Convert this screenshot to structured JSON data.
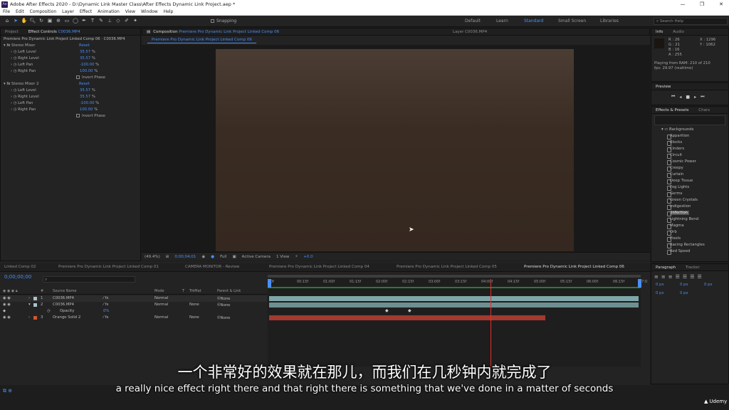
{
  "window": {
    "title": "Adobe After Effects 2020 - D:\\Dynamic Link Master Class\\After Effects Dynamic Link Project.aep *",
    "logo": "Ae",
    "controls": [
      "—",
      "❐",
      "✕"
    ]
  },
  "menu": [
    "File",
    "Edit",
    "Composition",
    "Layer",
    "Effect",
    "Animation",
    "View",
    "Window",
    "Help"
  ],
  "toolbar": {
    "snapping_label": "Snapping",
    "workspaces": [
      "Default",
      "Learn",
      "Standard",
      "Small Screen",
      "Libraries"
    ],
    "active_workspace": "Standard",
    "search_placeholder": "Search Help"
  },
  "left_panel": {
    "tabs": [
      "Project",
      "Effect Controls"
    ],
    "effect_controls_target": "C0036.MP4",
    "breadcrumb": "Premiere Pro Dynamic Link Project Linked Comp 06 · C0036.MP4",
    "effects": [
      {
        "name": "Stereo Mixer",
        "reset": "Reset",
        "params": [
          {
            "label": "Left Level",
            "value": "35.57",
            "unit": "%"
          },
          {
            "label": "Right Level",
            "value": "35.57",
            "unit": "%"
          },
          {
            "label": "Left Pan",
            "value": "-100.00",
            "unit": "%"
          },
          {
            "label": "Right Pan",
            "value": "100.00",
            "unit": "%"
          }
        ],
        "checkbox": "Invert Phase"
      },
      {
        "name": "Stereo Mixer 2",
        "reset": "Reset",
        "params": [
          {
            "label": "Left Level",
            "value": "35.57",
            "unit": "%"
          },
          {
            "label": "Right Level",
            "value": "35.57",
            "unit": "%"
          },
          {
            "label": "Left Pan",
            "value": "-100.00",
            "unit": "%"
          },
          {
            "label": "Right Pan",
            "value": "100.00",
            "unit": "%"
          }
        ],
        "checkbox": "Invert Phase"
      }
    ]
  },
  "composition_panel": {
    "tab_label": "Composition",
    "comp_name": "Premiere Pro Dynamic Link Project Linked Comp 06",
    "layer_tab": "Layer C0036.MP4",
    "sub_tab": "Premiere Pro Dynamic Link Project Linked Comp 06",
    "viewer": {
      "zoom": "(49.4%)",
      "timecode": "0;00;04;01",
      "resolution": "Full",
      "camera": "Active Camera",
      "views": "1 View",
      "exposure": "+0.0"
    }
  },
  "right_panel": {
    "info_tabs": [
      "Info",
      "Audio"
    ],
    "color": [
      {
        "k": "R",
        "v": "26"
      },
      {
        "k": "G",
        "v": "21"
      },
      {
        "k": "B",
        "v": "16"
      },
      {
        "k": "A",
        "v": "255"
      }
    ],
    "coords": [
      {
        "k": "X",
        "v": "1296"
      },
      {
        "k": "Y",
        "v": "1062"
      }
    ],
    "playing_line1": "Playing from RAM: 210 of 210",
    "playing_line2": "fps: 29.97 (realtime)",
    "preview_tab": "Preview",
    "effects_tabs": [
      "Effects & Presets",
      "Chars"
    ],
    "effects_folder": "Backgrounds",
    "effects_list": [
      "Apparition",
      "Blocks",
      "Cinders",
      "Circuit",
      "Cosmic Power",
      "Creepy",
      "Curtain",
      "Deep Tissue",
      "Fog Lights",
      "Germs",
      "Green Crystals",
      "Indigestion",
      "Infection",
      "Lightning Bend",
      "Magma",
      "Orb",
      "Pixels",
      "Racing Rectangles",
      "Red Speed"
    ],
    "selected_effect": "Infection",
    "paragraph_tabs": [
      "Paragraph",
      "Tracker"
    ],
    "paragraph_values": [
      "0 px",
      "0 px",
      "0 px",
      "0 px",
      "0 px"
    ]
  },
  "timeline": {
    "timecode": "0;00;00;00",
    "tabs": [
      "Linked Comp 02",
      "Premiere Pro Dynamic Link Project Linked Comp 01",
      "CAMERA MONITOR - Review",
      "Premiere Pro Dynamic Link Project Linked Comp 04",
      "Premiere Pro Dynamic Link Project Linked Comp 05",
      "Premiere Pro Dynamic Link Project Linked Comp 06"
    ],
    "active_tab": "Premiere Pro Dynamic Link Project Linked Comp 06",
    "columns": [
      "#",
      "Source Name",
      "Mode",
      "T",
      "TrkMat",
      "Parent & Link"
    ],
    "ruler": [
      "0f",
      "00:15f",
      "01:00f",
      "01:15f",
      "02:00f",
      "02:15f",
      "03:00f",
      "03:15f",
      "04:00f",
      "04:15f",
      "05:00f",
      "05:15f",
      "06:00f",
      "06:15f",
      "07:0"
    ],
    "layers": [
      {
        "num": "1",
        "name": "C0036.MP4",
        "mode": "Normal",
        "trkmat": "",
        "parent": "None",
        "color": "#a8c3c9"
      },
      {
        "num": "2",
        "name": "C0036.MP4",
        "mode": "Normal",
        "trkmat": "None",
        "parent": "None",
        "color": "#a8c3c9"
      },
      {
        "num": "",
        "name": "Opacity",
        "mode": "",
        "trkmat": "",
        "parent": "",
        "value": "0%",
        "color": ""
      },
      {
        "num": "3",
        "name": "Orange Solid 2",
        "mode": "Normal",
        "trkmat": "None",
        "parent": "None",
        "color": "#d4562e"
      }
    ],
    "playhead_frac": 0.597
  },
  "subtitles": {
    "cn": "一个非常好的效果就在那儿，而我们在几秒钟内就完成了",
    "en": "a really nice effect right there and that right there is something that we've done in a matter of seconds"
  },
  "watermark": "Udemy",
  "colors": {
    "accent": "#4a8ff7",
    "bg": "#232323",
    "selected_track": "#7fa6a8",
    "solid_track": "#a23a2f",
    "playhead": "#e03030"
  }
}
